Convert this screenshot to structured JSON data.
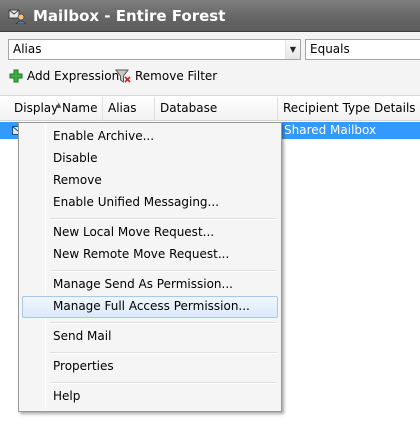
{
  "window": {
    "title": "Mailbox - Entire Forest",
    "icon": "mailbox-icon"
  },
  "filter": {
    "field_value": "Alias",
    "operator_value": "Equals",
    "add_expression_label": "Add Expression",
    "remove_filter_label": "Remove Filter"
  },
  "grid": {
    "columns": [
      "Display Name",
      "Alias",
      "Database",
      "Recipient Type Details"
    ],
    "selected_row": {
      "recipient_type": "Shared Mailbox"
    },
    "selection_color": "#3399ff"
  },
  "context_menu": {
    "items": [
      "Enable Archive...",
      "Disable",
      "Remove",
      "Enable Unified Messaging...",
      "New Local Move Request...",
      "New Remote Move Request...",
      "Manage Send As Permission...",
      "Manage Full Access Permission...",
      "Send Mail",
      "Properties",
      "Help"
    ],
    "highlighted_item": "Manage Full Access Permission..."
  }
}
